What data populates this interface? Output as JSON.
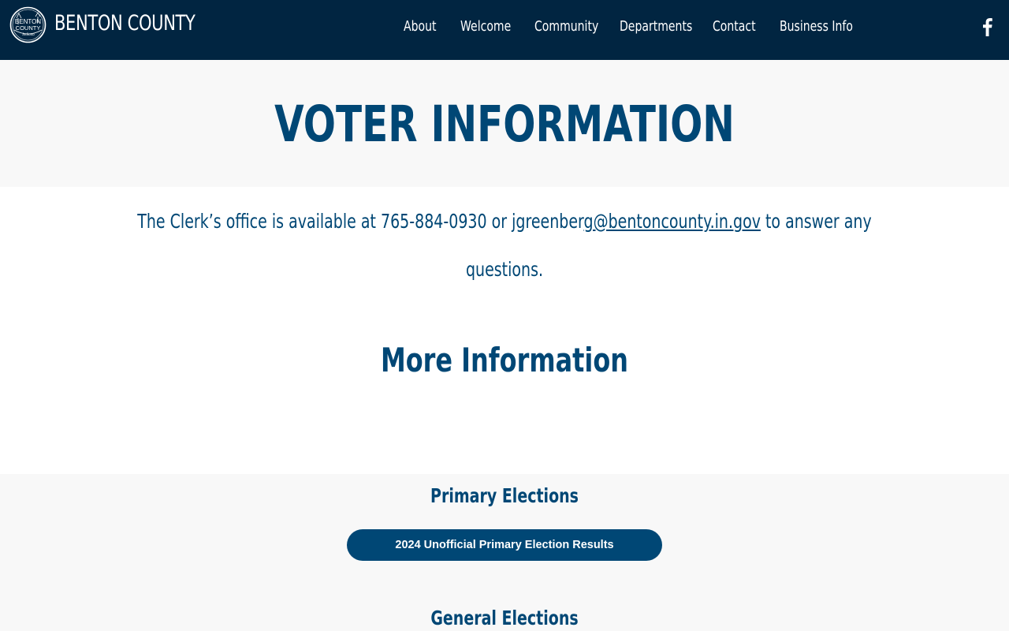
{
  "header": {
    "site_name": "BENTON COUNTY",
    "seal_text": [
      "BENTON",
      "COUNTY",
      "Indiana"
    ],
    "nav": [
      {
        "label": "About"
      },
      {
        "label": "Welcome"
      },
      {
        "label": "Community"
      },
      {
        "label": "Departments"
      },
      {
        "label": "Contact"
      },
      {
        "label": "Business Info"
      }
    ],
    "social_icon": "facebook-icon"
  },
  "page": {
    "title": "VOTER INFORMATION",
    "contact": {
      "prefix": "The Clerk’s office is available at 765-884-0930 or jgreenber",
      "email_link": "g@bentoncounty.in.gov",
      "suffix": " to answer any",
      "line2": "questions."
    },
    "more_info_heading": "More Information"
  },
  "elections": {
    "primary_heading": "Primary Elections",
    "primary_button": "2024 Unofficial Primary Election Results",
    "general_heading": "General Elections"
  },
  "colors": {
    "header_bg": "#012541",
    "accent": "#004775",
    "band_bg": "#f8f8f8"
  }
}
